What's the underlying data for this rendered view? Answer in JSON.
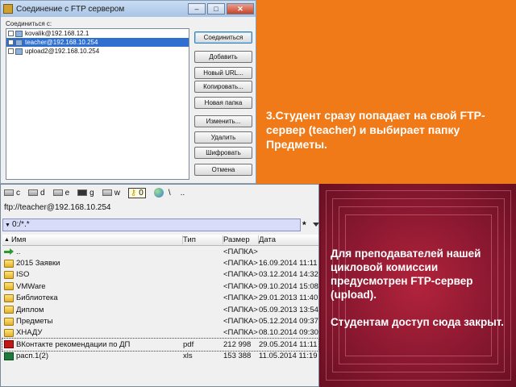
{
  "dialog": {
    "title": "Соединение с FTP сервером",
    "list_label": "Соединиться с:",
    "connections": [
      {
        "label": "kovalik@192.168.12.1",
        "selected": false
      },
      {
        "label": "teacher@192.168.10.254",
        "selected": true
      },
      {
        "label": "upload2@192.168.10.254",
        "selected": false
      }
    ],
    "buttons": {
      "connect": "Соединиться",
      "add": "Добавить",
      "new_url": "Новый URL...",
      "copy": "Копировать...",
      "new_folder": "Новая папка",
      "edit": "Изменить...",
      "delete": "Удалить",
      "encrypt": "Шифровать",
      "cancel": "Отмена"
    }
  },
  "file_manager": {
    "drives": {
      "c": "c",
      "d": "d",
      "e": "e",
      "g": "g",
      "w": "w",
      "zero": "0",
      "root": "\\",
      "parent": ".."
    },
    "path": "ftp://teacher@192.168.10.254",
    "filter": "0:/*.*",
    "star": "*",
    "columns": {
      "name": "Имя",
      "type": "Тип",
      "size": "Размер",
      "date": "Дата"
    },
    "rows": [
      {
        "icon": "up",
        "name": "..",
        "type": "",
        "size": "<ПАПКА>",
        "date": ""
      },
      {
        "icon": "folder",
        "name": "2015 Заявки",
        "type": "",
        "size": "<ПАПКА>",
        "date": "16.09.2014 11:11"
      },
      {
        "icon": "folder",
        "name": "ISO",
        "type": "",
        "size": "<ПАПКА>",
        "date": "03.12.2014 14:32"
      },
      {
        "icon": "folder",
        "name": "VMWare",
        "type": "",
        "size": "<ПАПКА>",
        "date": "09.10.2014 15:08"
      },
      {
        "icon": "folder",
        "name": "Библиотека",
        "type": "",
        "size": "<ПАПКА>",
        "date": "29.01.2013 11:40"
      },
      {
        "icon": "folder",
        "name": "Диплом",
        "type": "",
        "size": "<ПАПКА>",
        "date": "05.09.2013 13:54"
      },
      {
        "icon": "folder",
        "name": "Предметы",
        "type": "",
        "size": "<ПАПКА>",
        "date": "05.12.2014 09:37"
      },
      {
        "icon": "folder",
        "name": "ХНАДУ",
        "type": "",
        "size": "<ПАПКА>",
        "date": "08.10.2014 09:30"
      },
      {
        "icon": "pdf",
        "name": "ВКонтакте рекомендации по ДП",
        "type": "pdf",
        "size": "212 998",
        "date": "29.05.2014 11:11"
      },
      {
        "icon": "xls",
        "name": "расп.1(2)",
        "type": "xls",
        "size": "153 388",
        "date": "11.05.2014 11:19"
      }
    ]
  },
  "slide": {
    "text_top": "3.Студент сразу попадает на свой FTP-сервер (teacher) и выбирает папку Предметы.",
    "text_bottom_1": "Для преподавателей нашей цикловой комиссии предусмотрен FTP-сервер (upload).",
    "text_bottom_2": "Студентам доступ сюда закрыт."
  },
  "colors": {
    "orange": "#f07a18",
    "maroon": "#6a0f22",
    "selection": "#2f6fd0"
  }
}
